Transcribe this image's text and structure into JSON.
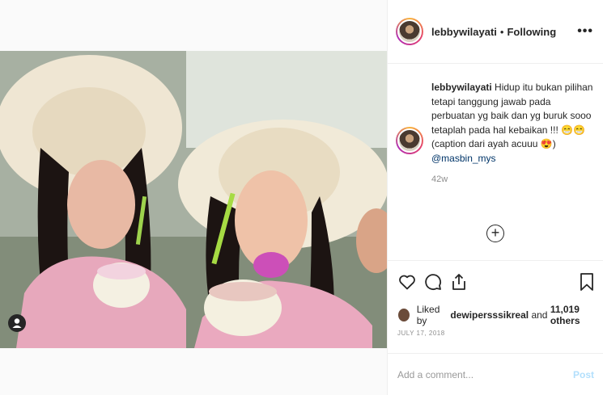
{
  "post": {
    "image_alt": "Two women in wide straw hats holding coconut desserts",
    "user_tag_icon": "user-icon"
  },
  "header": {
    "username": "lebbywilayati",
    "separator": "•",
    "follow_state": "Following",
    "more_icon": "more-icon",
    "more_label": "•••"
  },
  "caption": {
    "username": "lebbywilayati",
    "text": "Hidup itu bukan pilihan tetapi tanggung jawab pada perbuatan yg baik dan yg buruk sooo tetaplah pada hal kebaikan !!! 😁😁 (caption dari ayah acuuu 😍)",
    "mention": "@masbin_mys",
    "time": "42w"
  },
  "load_more": {
    "icon": "plus-circle-icon",
    "label": "+"
  },
  "actions": {
    "like_icon": "heart-icon",
    "comment_icon": "comment-icon",
    "share_icon": "share-icon",
    "save_icon": "bookmark-icon"
  },
  "likes": {
    "prefix": "Liked by",
    "user": "dewipersssikreal",
    "conjunction": "and",
    "count_text": "11,019 others"
  },
  "date": "JULY 17, 2018",
  "comment": {
    "placeholder": "Add a comment...",
    "post_label": "Post"
  },
  "colors": {
    "mention": "#003569",
    "post_disabled": "#b2dffc",
    "muted": "#8e8e8e"
  }
}
